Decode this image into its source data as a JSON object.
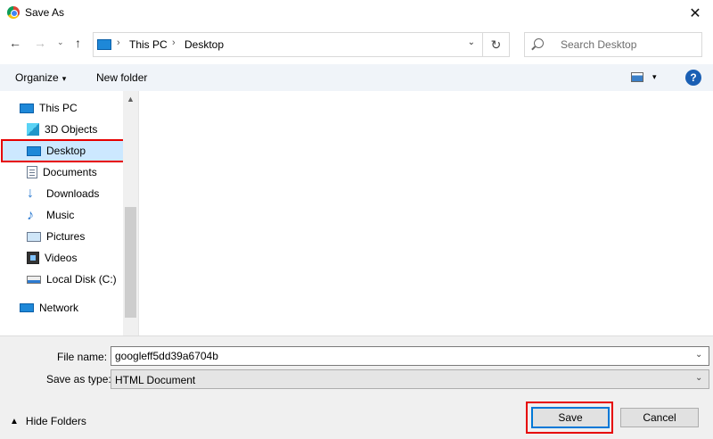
{
  "window": {
    "title": "Save As",
    "close_glyph": "✕"
  },
  "nav": {
    "back_glyph": "←",
    "forward_glyph": "→",
    "recent_glyph": "⌄",
    "up_glyph": "↑",
    "breadcrumb": [
      "This PC",
      "Desktop"
    ],
    "crumb_sep": "›",
    "dropdown_glyph": "⌄",
    "refresh_glyph": "↻",
    "search_placeholder": "Search Desktop"
  },
  "toolbar": {
    "organize_label": "Organize",
    "caret": "▾",
    "new_folder_label": "New folder",
    "help_glyph": "?"
  },
  "sidebar": {
    "items": [
      {
        "label": "This PC",
        "icon": "pc-icon"
      },
      {
        "label": "3D Objects",
        "icon": "cube-icon"
      },
      {
        "label": "Desktop",
        "icon": "desktop-icon",
        "selected": true
      },
      {
        "label": "Documents",
        "icon": "documents-icon"
      },
      {
        "label": "Downloads",
        "icon": "download-arrow-icon"
      },
      {
        "label": "Music",
        "icon": "music-note-icon"
      },
      {
        "label": "Pictures",
        "icon": "pictures-icon"
      },
      {
        "label": "Videos",
        "icon": "film-icon"
      },
      {
        "label": "Local Disk (C:)",
        "icon": "disk-drive-icon"
      },
      {
        "label": "Network",
        "icon": "network-icon"
      }
    ],
    "scroll_up_glyph": "▲"
  },
  "form": {
    "file_name_label": "File name:",
    "file_name_value": "googleff5dd39a6704b",
    "save_type_label": "Save as type:",
    "save_type_value": "HTML Document",
    "combo_caret": "⌄"
  },
  "footer": {
    "hide_folders_label": "Hide Folders",
    "hide_caret": "▲",
    "save_label": "Save",
    "cancel_label": "Cancel"
  },
  "colors": {
    "accent": "#0078d7",
    "highlight_outline": "#e60000",
    "selected_bg": "#cce8ff"
  }
}
